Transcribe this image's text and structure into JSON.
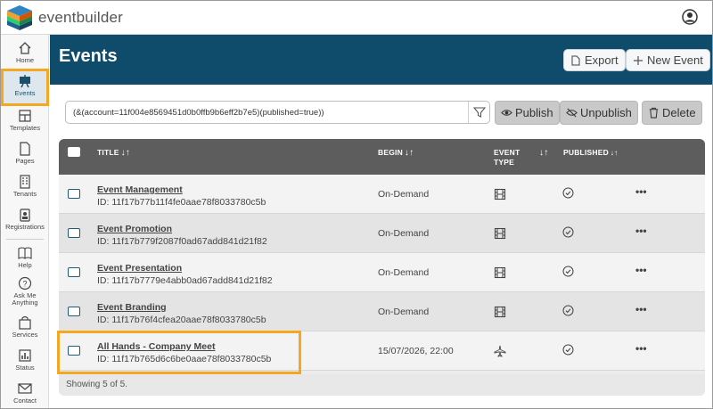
{
  "app": {
    "brand": "eventbuilder"
  },
  "sidebar": {
    "items": [
      {
        "label": "Home",
        "icon": "home-icon"
      },
      {
        "label": "Events",
        "icon": "easel-icon"
      },
      {
        "label": "Templates",
        "icon": "layout-icon"
      },
      {
        "label": "Pages",
        "icon": "page-icon"
      },
      {
        "label": "Tenants",
        "icon": "building-icon"
      },
      {
        "label": "Registrations",
        "icon": "badge-icon"
      },
      {
        "label": "Help",
        "icon": "book-icon"
      },
      {
        "label": "Ask Me Anything",
        "icon": "question-icon"
      },
      {
        "label": "Services",
        "icon": "bag-icon"
      },
      {
        "label": "Status",
        "icon": "bar-chart-icon"
      },
      {
        "label": "Contact",
        "icon": "mail-icon"
      }
    ]
  },
  "header": {
    "title": "Events",
    "export_label": "Export",
    "new_event_label": "New Event"
  },
  "filter": {
    "value": "(&(account=11f004e8569451d0b0ffb9b6eff2b7e5)(published=true))"
  },
  "actions": {
    "publish": "Publish",
    "unpublish": "Unpublish",
    "delete": "Delete"
  },
  "table": {
    "columns": {
      "title": "TITLE",
      "begin": "BEGIN",
      "event_type_1": "EVENT",
      "event_type_2": "TYPE",
      "published": "PUBLISHED"
    },
    "rows": [
      {
        "title": "Event Management",
        "id": "ID: 11f17b77b11f4fe0aae78f8033780c5b",
        "begin": "On-Demand",
        "type_icon": "film-icon",
        "published": true
      },
      {
        "title": "Event Promotion",
        "id": "ID: 11f17b779f2087f0ad67add841d21f82",
        "begin": "On-Demand",
        "type_icon": "film-icon",
        "published": true
      },
      {
        "title": "Event Presentation",
        "id": "ID: 11f17b7779e4abb0ad67add841d21f82",
        "begin": "On-Demand",
        "type_icon": "film-icon",
        "published": true
      },
      {
        "title": "Event Branding",
        "id": "ID: 11f17b76f4cfea20aae78f8033780c5b",
        "begin": "On-Demand",
        "type_icon": "film-icon",
        "published": true
      },
      {
        "title": "All Hands - Company Meet",
        "id": "ID: 11f17b765d6c6be0aae78f8033780c5b",
        "begin": "15/07/2026, 22:00",
        "type_icon": "airplane-icon",
        "published": true
      }
    ],
    "more_label": "•••",
    "footer": "Showing 5 of 5."
  },
  "colors": {
    "header": "#0f4c6b",
    "highlight": "#f5a623",
    "table_head": "#5d5d5d"
  }
}
